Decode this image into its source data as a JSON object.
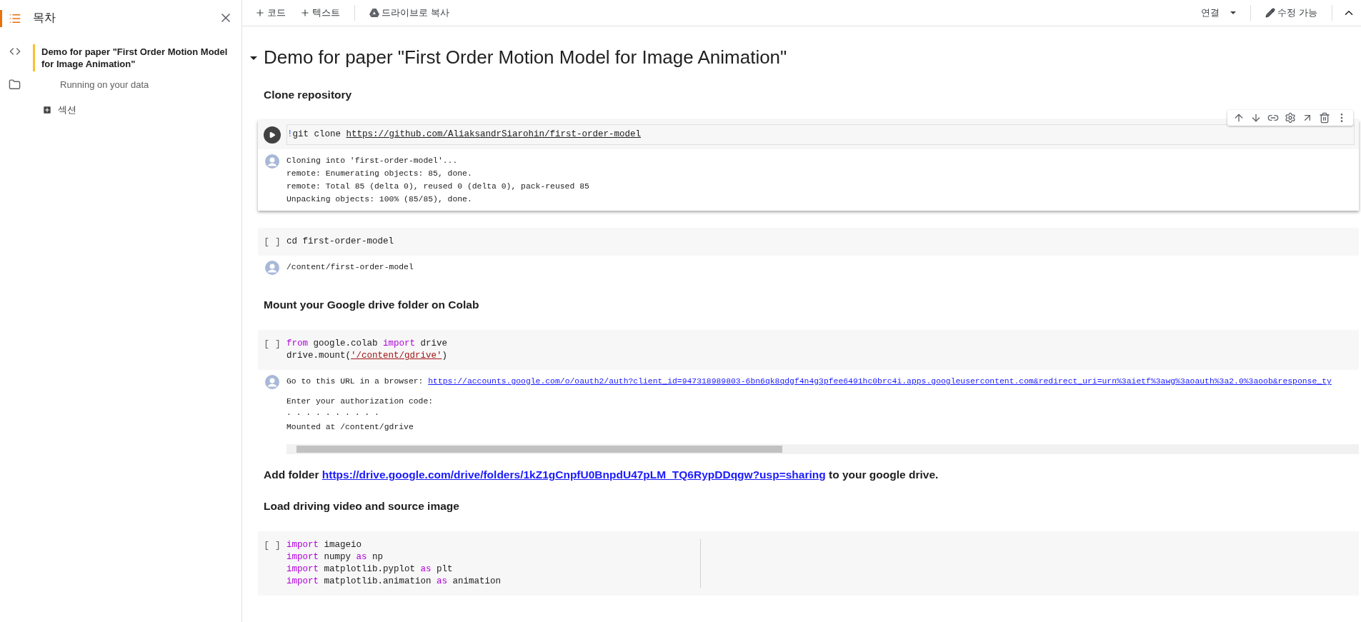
{
  "rail": [
    {
      "kind": "toc",
      "selected": true
    },
    {
      "kind": "code",
      "selected": false
    },
    {
      "kind": "files",
      "selected": false
    }
  ],
  "sidebar": {
    "title": "목차",
    "items": [
      {
        "label": "Demo for paper \"First Order Motion Model for Image Animation\"",
        "selected": true,
        "children": [
          {
            "label": "Running on your data",
            "selected": false
          }
        ]
      }
    ],
    "add_section": "섹션"
  },
  "toolbar": {
    "add_code": "코드",
    "add_text": "텍스트",
    "copy_to_drive": "드라이브로 복사",
    "connect": "연결",
    "edit": "수정 가능"
  },
  "notebook": {
    "title": "Demo for paper \"First Order Motion Model for Image Animation\"",
    "expanded": true,
    "cells": [
      {
        "kind": "heading",
        "parts": [
          {
            "text": "Clone repository"
          }
        ]
      },
      {
        "kind": "code",
        "active": true,
        "lines": [
          [
            {
              "text": "!",
              "kind": "bang"
            },
            {
              "text": "git clone "
            },
            {
              "text": "https://github.com/AliaksandrSiarohin/first-order-model",
              "kind": "link"
            }
          ]
        ],
        "output": {
          "blocks": [
            [
              [
                {
                  "text": "Cloning into 'first-order-model'..."
                }
              ],
              [
                {
                  "text": "remote: Enumerating objects: 85, done."
                }
              ],
              [
                {
                  "text": "remote: Total 85 (delta 0), reused 0 (delta 0), pack-reused 85"
                }
              ],
              [
                {
                  "text": "Unpacking objects: 100% (85/85), done."
                }
              ]
            ]
          ]
        }
      },
      {
        "kind": "code",
        "active": false,
        "prompt": "[ ]",
        "lines": [
          [
            {
              "text": "cd first-order-model"
            }
          ]
        ],
        "output": {
          "blocks": [
            [
              [
                {
                  "text": "/content/first-order-model"
                }
              ]
            ]
          ]
        }
      },
      {
        "kind": "heading",
        "parts": [
          {
            "text": "Mount your Google drive folder on Colab"
          }
        ]
      },
      {
        "kind": "code",
        "active": false,
        "prompt": "[ ]",
        "lines": [
          [
            {
              "text": "from",
              "kind": "keyword"
            },
            {
              "text": " google.colab "
            },
            {
              "text": "import",
              "kind": "keyword"
            },
            {
              "text": " drive"
            }
          ],
          [
            {
              "text": "drive.mount("
            },
            {
              "text": "'/content/gdrive'",
              "kind": "string"
            },
            {
              "text": ")"
            }
          ]
        ],
        "output": {
          "scrollable": true,
          "blocks": [
            [
              [
                {
                  "text": "Go to this URL in a browser: "
                },
                {
                  "text": "https://accounts.google.com/o/oauth2/auth?client_id=947318989803-6bn6qk8qdgf4n4g3pfee6491hc0brc4i.apps.googleusercontent.com&redirect_uri=urn%3aietf%3awg%3aoauth%3a2.0%3aoob&response_ty",
                  "kind": "link"
                }
              ]
            ],
            [
              [
                {
                  "text": "Enter your authorization code:"
                }
              ],
              [
                {
                  "text": "· · · · · · · · · ·"
                }
              ],
              [
                {
                  "text": "Mounted at /content/gdrive"
                }
              ]
            ]
          ]
        }
      },
      {
        "kind": "paragraph",
        "parts": [
          {
            "text": "Add folder "
          },
          {
            "text": "https://drive.google.com/drive/folders/1kZ1gCnpfU0BnpdU47pLM_TQ6RypDDqgw?usp=sharing",
            "link": true
          },
          {
            "text": " to your google drive."
          }
        ]
      },
      {
        "kind": "heading",
        "parts": [
          {
            "text": "Load driving video and source image"
          }
        ]
      },
      {
        "kind": "code",
        "active": false,
        "prompt": "[ ]",
        "ruler": true,
        "lines": [
          [
            {
              "text": "import",
              "kind": "keyword"
            },
            {
              "text": " imageio"
            }
          ],
          [
            {
              "text": "import",
              "kind": "keyword"
            },
            {
              "text": " numpy "
            },
            {
              "text": "as",
              "kind": "keyword"
            },
            {
              "text": " np"
            }
          ],
          [
            {
              "text": "import",
              "kind": "keyword"
            },
            {
              "text": " matplotlib.pyplot "
            },
            {
              "text": "as",
              "kind": "keyword"
            },
            {
              "text": " plt"
            }
          ],
          [
            {
              "text": "import",
              "kind": "keyword"
            },
            {
              "text": " matplotlib.animation "
            },
            {
              "text": "as",
              "kind": "keyword"
            },
            {
              "text": " animation"
            }
          ]
        ]
      }
    ]
  }
}
